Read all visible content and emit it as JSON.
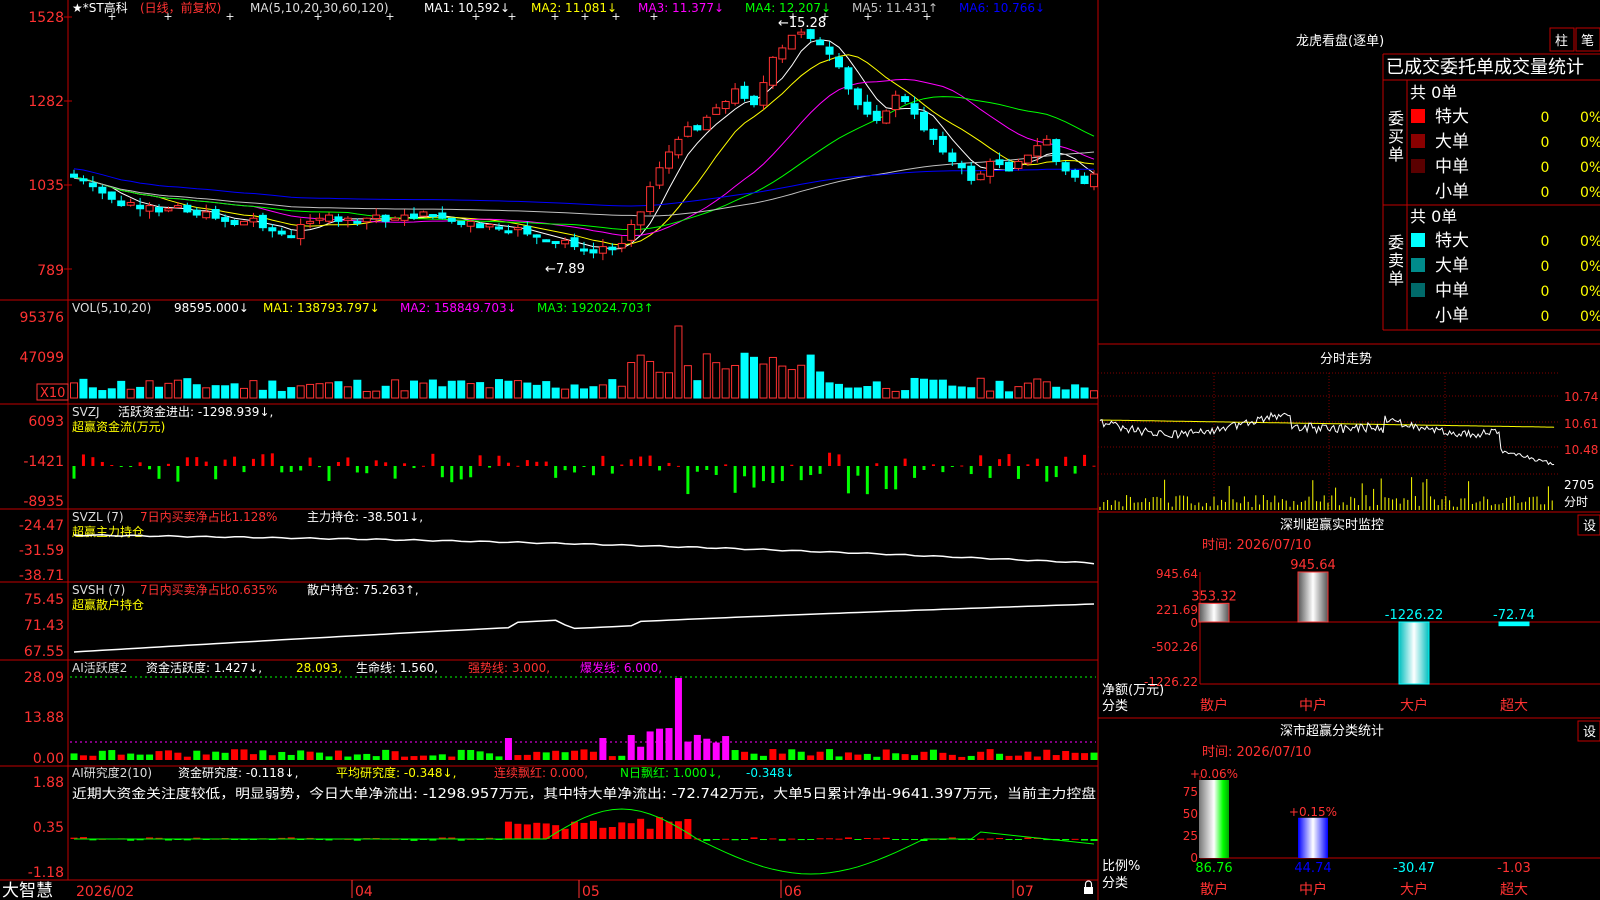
{
  "colors": {
    "up": "#ff3232",
    "down": "#00ffff",
    "frame": "#c00000",
    "ma1": "#ffffff",
    "ma2": "#ffff00",
    "ma3": "#ff00ff",
    "ma4": "#00ff00",
    "ma5": "#c0c0c0",
    "ma6": "#0000ff",
    "bar_up": "#ff0000",
    "bar_down": "#00ff00",
    "text_red": "#ff3232",
    "text_yellow": "#ffff00",
    "text_white": "#ffffff",
    "text_cyan": "#00ffff"
  },
  "bottom_bar": {
    "brand": "大智慧",
    "date_labels": [
      "2026/02",
      "04",
      "05",
      "06",
      "07"
    ]
  },
  "price": {
    "header": {
      "name": "★*ST高科",
      "mode": "(日线，前复权)",
      "ma_label": "MA(5,10,20,30,60,120)",
      "ma1": "MA1: 10.592↓",
      "ma2": "MA2: 11.081↓",
      "ma3": "MA3: 11.377↓",
      "ma4": "MA4: 12.207↓",
      "ma5": "MA5: 11.431↑",
      "ma6": "MA6: 10.766↓"
    },
    "yticks": [
      "1528",
      "1282",
      "1035",
      "789"
    ],
    "high_label": "←15.28",
    "low_label": "←7.89"
  },
  "volume": {
    "header": {
      "name": "VOL(5,10,20)",
      "value": "98595.000↓",
      "ma1": "MA1: 138793.797↓",
      "ma2": "MA2: 158849.703↓",
      "ma3": "MA3: 192024.703↑"
    },
    "yticks": [
      "95376",
      "47099"
    ],
    "unit": "X10"
  },
  "svzj": {
    "header": {
      "name": "SVZJ",
      "label": "活跃资金进出: -1298.939↓,",
      "sub": "超赢资金流(万元)"
    },
    "yticks": [
      "6093",
      "-1421",
      "-8935"
    ]
  },
  "svzl": {
    "header": {
      "name": "SVZL (7)",
      "ratio": "7日内买卖净占比1.128%",
      "hold": "主力持仓: -38.501↓,",
      "sub": "超赢主力持仓"
    },
    "yticks": [
      "-24.47",
      "-31.59",
      "-38.71"
    ]
  },
  "svsh": {
    "header": {
      "name": "SVSH (7)",
      "ratio": "7日内买卖净占比0.635%",
      "hold": "散户持仓: 75.263↑,",
      "sub": "超赢散户持仓"
    },
    "yticks": [
      "75.45",
      "71.43",
      "67.55"
    ]
  },
  "ai_active": {
    "header": {
      "name": "AI活跃度2",
      "a": "资金活跃度: 1.427↓,",
      "b": "28.093,",
      "c": "生命线: 1.560,",
      "d": "强势线: 3.000,",
      "e": "爆发线: 6.000,"
    },
    "yticks": [
      "28.09",
      "13.88",
      "0.00"
    ]
  },
  "ai_research": {
    "header": {
      "name": "AI研究度2(10)",
      "a": "资金研究度: -0.118↓,",
      "b": "平均研究度: -0.348↓,",
      "c": "连续飘红: 0.000,",
      "d": "N日飘红: 1.000↓,",
      "e": "-0.348↓"
    },
    "commentary": "近期大资金关注度较低，明显弱势，今日大单净流出: -1298.957万元，其中特大单净流出: -72.742万元，大单5日累计净出-9641.397万元，当前主力控盘",
    "yticks": [
      "1.88",
      "0.35",
      "-1.18"
    ]
  },
  "right": {
    "lhb": {
      "title": "龙虎看盘(逐单)",
      "btn1": "柱",
      "btn2": "笔",
      "subtitle": "已成交委托单成交量统计",
      "buy": {
        "label": "委买单",
        "total": "共 0单",
        "rows": [
          {
            "name": "特大",
            "count": "0",
            "pct": "0%",
            "color": "#ff0000"
          },
          {
            "name": "大单",
            "count": "0",
            "pct": "0%",
            "color": "#8b0000"
          },
          {
            "name": "中单",
            "count": "0",
            "pct": "0%",
            "color": "#5a0000"
          },
          {
            "name": "小单",
            "count": "0",
            "pct": "0%",
            "color": ""
          }
        ]
      },
      "sell": {
        "label": "委卖单",
        "total": "共 0单",
        "rows": [
          {
            "name": "特大",
            "count": "0",
            "pct": "0%",
            "color": "#00ffff"
          },
          {
            "name": "大单",
            "count": "0",
            "pct": "0%",
            "color": "#008b8b"
          },
          {
            "name": "中单",
            "count": "0",
            "pct": "0%",
            "color": "#006a6a"
          },
          {
            "name": "小单",
            "count": "0",
            "pct": "0%",
            "color": ""
          }
        ]
      }
    },
    "intraday": {
      "title": "分时走势",
      "yticks": [
        "10.74",
        "10.61",
        "10.48"
      ],
      "vol_label": "2705",
      "unit": "分时"
    },
    "monitor": {
      "title": "深圳超赢实时监控",
      "btn": "设",
      "time": "时间: 2026/07/10",
      "yticks": [
        "945.64",
        "221.69",
        "0",
        "-502.26",
        "-1226.22"
      ],
      "ylabel": "净额(万元)",
      "xlabel": "分类",
      "categories": [
        "散户",
        "中户",
        "大户",
        "超大"
      ],
      "values": [
        353.32,
        945.64,
        -1226.22,
        -72.74
      ],
      "value_labels": [
        "353.32",
        "945.64",
        "-1226.22",
        "-72.74"
      ]
    },
    "classify": {
      "title": "深市超赢分类统计",
      "btn": "设",
      "time": "时间: 2026/07/10",
      "yticks": [
        "75",
        "50",
        "25",
        "0"
      ],
      "ylabel": "比例%",
      "xlabel": "分类",
      "categories": [
        "散户",
        "中户",
        "大户",
        "超大"
      ],
      "top_labels": [
        "+0.06%",
        "+0.15%"
      ],
      "bottom_labels": [
        "86.76",
        "44.74",
        "-30.47",
        "-1.03"
      ],
      "bar_values": [
        86.76,
        44.74
      ]
    }
  },
  "chart_data": {
    "type": "candlestick",
    "title": "★*ST高科 (日线，前复权)",
    "price_range": [
      7.89,
      15.28
    ],
    "yticks_printed": [
      "1528",
      "1282",
      "1035",
      "789"
    ],
    "x_labels": [
      "2026/02",
      "04",
      "05",
      "06",
      "07"
    ],
    "annotations": [
      "←15.28",
      "←7.89"
    ],
    "close": [
      10.4,
      10.3,
      10.1,
      9.9,
      9.7,
      9.5,
      9.6,
      9.4,
      9.5,
      9.3,
      9.4,
      9.5,
      9.3,
      9.2,
      9.3,
      9.1,
      9.0,
      8.9,
      9.0,
      9.1,
      8.8,
      8.7,
      8.6,
      8.5,
      8.9,
      9.0,
      9.1,
      9.2,
      9.0,
      9.1,
      9.0,
      9.1,
      9.2,
      9.0,
      9.1,
      9.2,
      9.1,
      9.3,
      9.2,
      9.1,
      9.0,
      8.9,
      9.0,
      8.8,
      8.9,
      8.8,
      8.7,
      8.8,
      8.6,
      8.5,
      8.4,
      8.3,
      8.4,
      8.2,
      8.1,
      8.0,
      8.2,
      8.1,
      8.3,
      8.9,
      9.3,
      10.1,
      10.7,
      11.2,
      11.6,
      12.0,
      11.9,
      12.3,
      12.6,
      12.8,
      13.2,
      12.9,
      12.7,
      13.4,
      14.2,
      14.5,
      14.9,
      15.0,
      14.8,
      14.6,
      14.3,
      13.9,
      13.2,
      12.7,
      12.4,
      12.2,
      12.5,
      13.0,
      12.8,
      12.4,
      11.9,
      11.6,
      11.2,
      10.9,
      10.7,
      10.3,
      10.5,
      10.9,
      10.8,
      10.6,
      10.9,
      11.1,
      11.4,
      11.6,
      10.9,
      10.6,
      10.4,
      10.2,
      10.5
    ],
    "volume_range": [
      0,
      95376
    ],
    "volume_yticks": [
      "95376",
      "47099"
    ],
    "svzj_range": [
      -8935,
      6093
    ],
    "svzl_range": [
      -38.71,
      -24.47
    ],
    "svsh_range": [
      67.55,
      75.45
    ],
    "ai_active_range": [
      0.0,
      28.09
    ],
    "ai_research_range": [
      -1.18,
      1.88
    ]
  }
}
